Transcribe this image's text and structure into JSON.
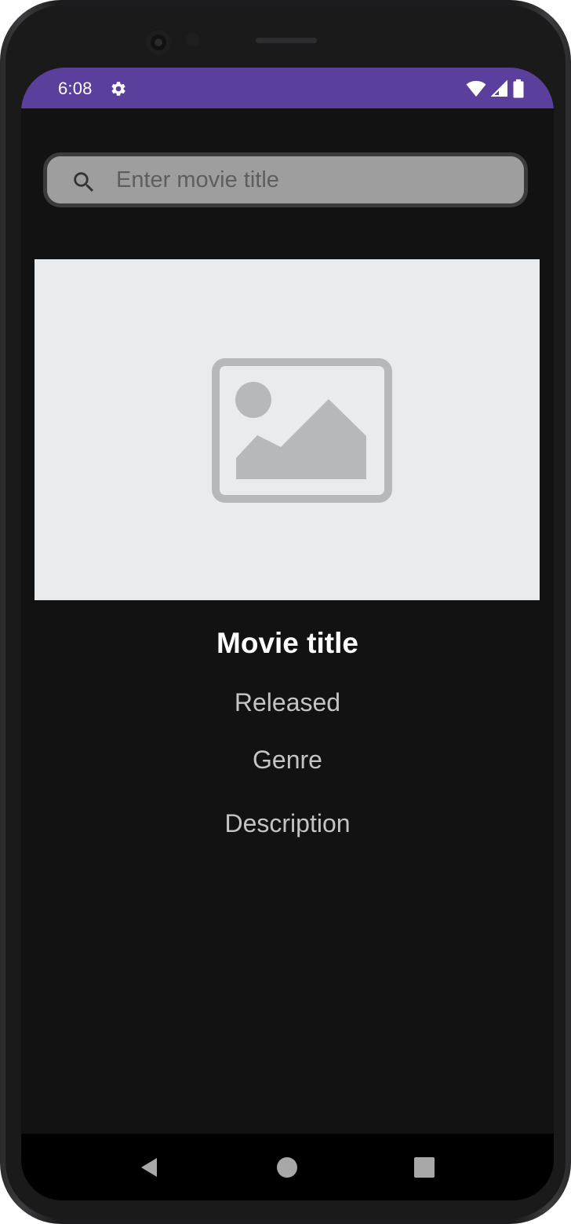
{
  "status_bar": {
    "time": "6:08",
    "color": "#5b3f9c",
    "icons": [
      "settings-gear-icon",
      "wifi-icon",
      "signal-icon",
      "battery-icon"
    ]
  },
  "search": {
    "placeholder": "Enter movie title",
    "value": "",
    "icon": "search-icon"
  },
  "poster": {
    "icon": "image-placeholder-icon"
  },
  "movie": {
    "title": "Movie title",
    "released": "Released",
    "genre": "Genre",
    "description": "Description"
  },
  "navigation": {
    "buttons": [
      "back-icon",
      "home-icon",
      "recents-icon"
    ]
  }
}
